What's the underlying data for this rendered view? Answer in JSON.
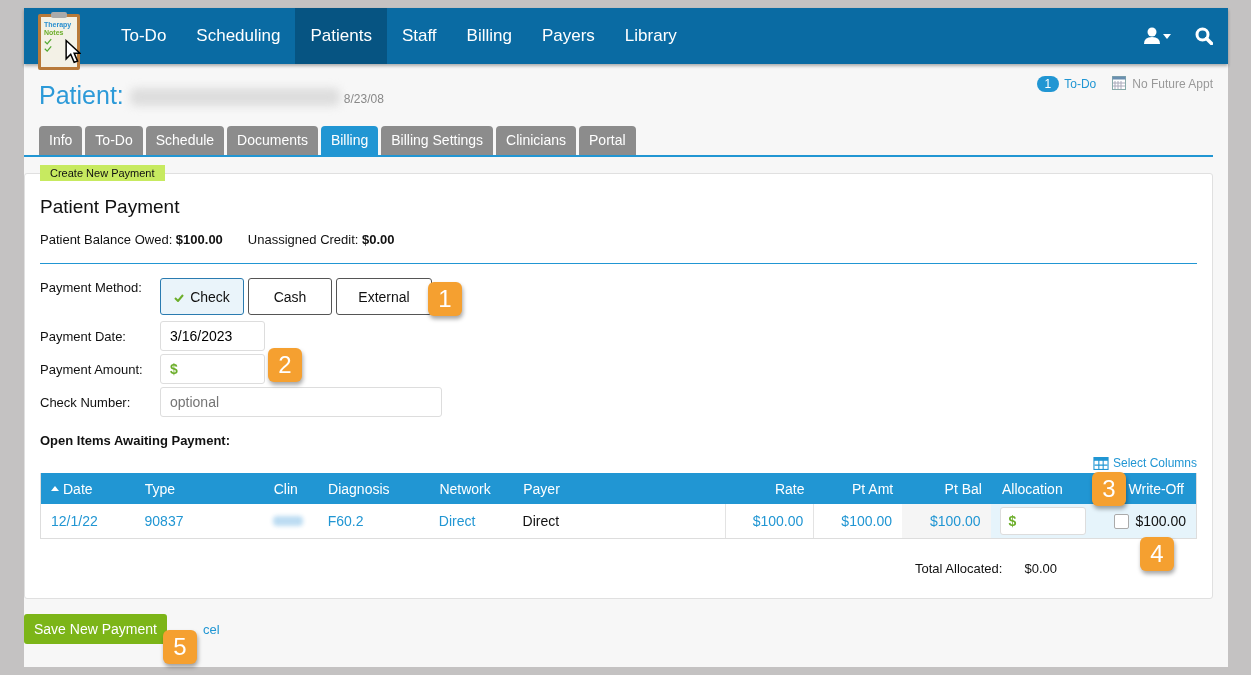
{
  "logo": {
    "line1": "Therapy",
    "line2": "Notes"
  },
  "nav": [
    {
      "label": "To-Do",
      "selected": false
    },
    {
      "label": "Scheduling",
      "selected": false
    },
    {
      "label": "Patients",
      "selected": true
    },
    {
      "label": "Staff",
      "selected": false
    },
    {
      "label": "Billing",
      "selected": false
    },
    {
      "label": "Payers",
      "selected": false
    },
    {
      "label": "Library",
      "selected": false
    }
  ],
  "header": {
    "title": "Patient:",
    "dob": "8/23/08",
    "todo_count": "1",
    "todo_label": "To-Do",
    "appt": "No Future Appt"
  },
  "tabs": [
    {
      "label": "Info",
      "selected": false
    },
    {
      "label": "To-Do",
      "selected": false
    },
    {
      "label": "Schedule",
      "selected": false
    },
    {
      "label": "Documents",
      "selected": false
    },
    {
      "label": "Billing",
      "selected": true
    },
    {
      "label": "Billing Settings",
      "selected": false
    },
    {
      "label": "Clinicians",
      "selected": false
    },
    {
      "label": "Portal",
      "selected": false
    }
  ],
  "panel": {
    "tag": "Create New Payment",
    "title": "Patient Payment",
    "balance_label": "Patient Balance Owed:",
    "balance": "$100.00",
    "credit_label": "Unassigned Credit:",
    "credit": "$0.00"
  },
  "form": {
    "method_label": "Payment Method:",
    "methods": [
      {
        "label": "Check",
        "selected": true
      },
      {
        "label": "Cash",
        "selected": false
      },
      {
        "label": "External",
        "selected": false
      }
    ],
    "date_label": "Payment Date:",
    "date_value": "3/16/2023",
    "amount_label": "Payment Amount:",
    "currency": "$",
    "check_label": "Check Number:",
    "check_placeholder": "optional"
  },
  "open_items": {
    "title": "Open Items Awaiting Payment:",
    "select_columns": "Select Columns",
    "columns": [
      "Date",
      "Type",
      "Clin",
      "Diagnosis",
      "Network",
      "Payer",
      "Rate",
      "Pt Amt",
      "Pt Bal",
      "Allocation",
      "Write-Off"
    ],
    "rows": [
      {
        "date": "12/1/22",
        "type": "90837",
        "diagnosis": "F60.2",
        "network": "Direct",
        "payer": "Direct",
        "rate": "$100.00",
        "pt_amt": "$100.00",
        "pt_bal": "$100.00",
        "currency": "$",
        "write_off_checked": false,
        "write_off": "$100.00"
      }
    ],
    "total_label": "Total Allocated:",
    "total": "$0.00"
  },
  "actions": {
    "save": "Save New Payment",
    "cancel": "cel"
  },
  "callouts": [
    "1",
    "2",
    "3",
    "4",
    "5"
  ]
}
